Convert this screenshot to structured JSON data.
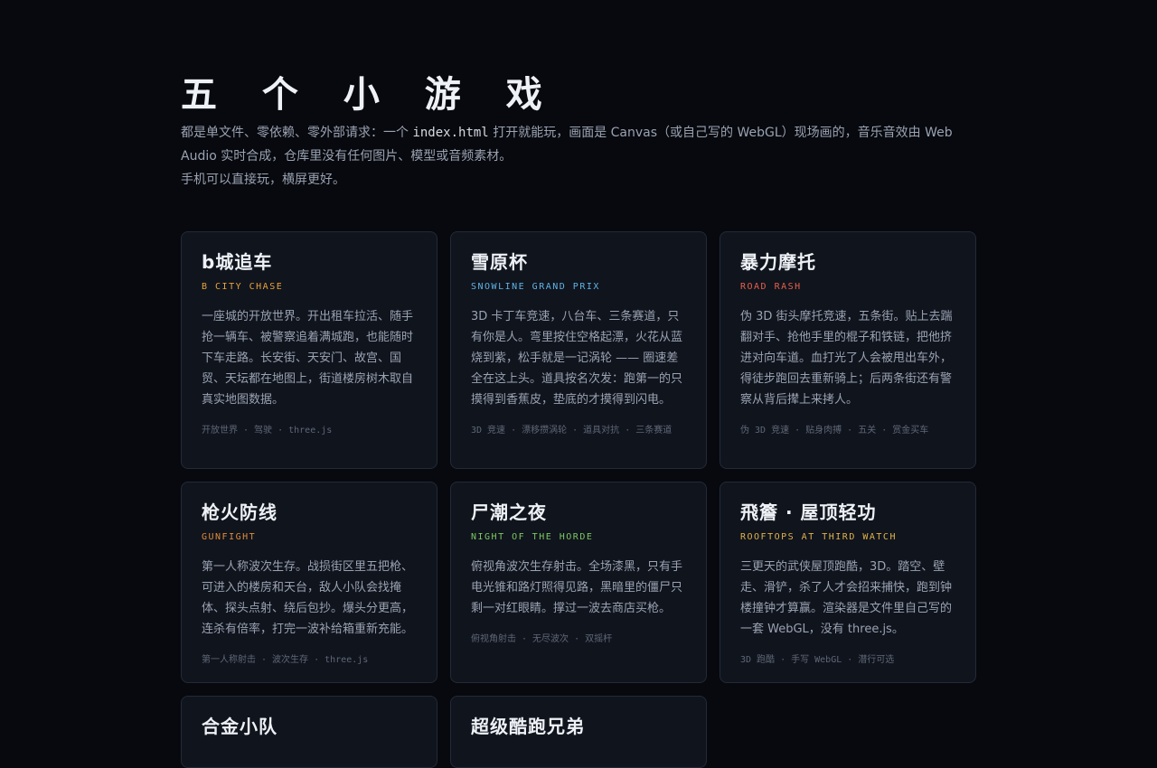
{
  "page": {
    "title": "五 个 小 游 戏",
    "intro_part1": "都是单文件、零依赖、零外部请求：一个 ",
    "intro_code": "index.html",
    "intro_part2": " 打开就能玩，画面是 Canvas（或自己写的 WebGL）现场画的，音乐音效由 Web Audio 实时合成，仓库里没有任何图片、模型或音频素材。",
    "intro_line2": "手机可以直接玩，横屏更好。"
  },
  "colors": {
    "orange": "#e9a23b",
    "blue": "#5fb3e6",
    "red": "#e8604a",
    "amber": "#e08a3a",
    "green": "#7cc860",
    "gold": "#e0b34a"
  },
  "cards": [
    {
      "title": "b城追车",
      "subtitle": "B CITY CHASE",
      "description": "一座城的开放世界。开出租车拉活、随手抢一辆车、被警察追着满城跑，也能随时下车走路。长安街、天安门、故宫、国贸、天坛都在地图上，街道楼房树木取自真实地图数据。",
      "tags": "开放世界 · 驾驶 · three.js"
    },
    {
      "title": "雪原杯",
      "subtitle": "SNOWLINE GRAND PRIX",
      "description": "3D 卡丁车竞速，八台车、三条赛道，只有你是人。弯里按住空格起漂，火花从蓝烧到紫，松手就是一记涡轮 —— 圈速差全在这上头。道具按名次发：跑第一的只摸得到香蕉皮，垫底的才摸得到闪电。",
      "tags": "3D 竞速 · 漂移攒涡轮 · 道具对抗 · 三条赛道"
    },
    {
      "title": "暴力摩托",
      "subtitle": "ROAD RASH",
      "description": "伪 3D 街头摩托竞速，五条街。贴上去踹翻对手、抢他手里的棍子和铁链，把他挤进对向车道。血打光了人会被甩出车外，得徒步跑回去重新骑上；后两条街还有警察从背后撵上来拷人。",
      "tags": "伪 3D 竞速 · 贴身肉搏 · 五关 · 赏金买车"
    },
    {
      "title": "枪火防线",
      "subtitle": "GUNFIGHT",
      "description": "第一人称波次生存。战损街区里五把枪、可进入的楼房和天台，敌人小队会找掩体、探头点射、绕后包抄。爆头分更高，连杀有倍率，打完一波补给箱重新充能。",
      "tags": "第一人称射击 · 波次生存 · three.js"
    },
    {
      "title": "尸潮之夜",
      "subtitle": "NIGHT OF THE HORDE",
      "description": "俯视角波次生存射击。全场漆黑，只有手电光锥和路灯照得见路，黑暗里的僵尸只剩一对红眼睛。撑过一波去商店买枪。",
      "tags": "俯视角射击 · 无尽波次 · 双摇杆"
    },
    {
      "title": "飛簷 · 屋顶轻功",
      "subtitle": "ROOFTOPS AT THIRD WATCH",
      "description": "三更天的武侠屋顶跑酷，3D。踏空、壁走、滑铲，杀了人才会招来捕快，跑到钟楼撞钟才算赢。渲染器是文件里自己写的一套 WebGL，没有 three.js。",
      "tags": "3D 跑酷 · 手写 WebGL · 潜行可选"
    },
    {
      "title": "合金小队",
      "subtitle": "",
      "description": "",
      "tags": ""
    },
    {
      "title": "超级酷跑兄弟",
      "subtitle": "",
      "description": "",
      "tags": ""
    }
  ]
}
